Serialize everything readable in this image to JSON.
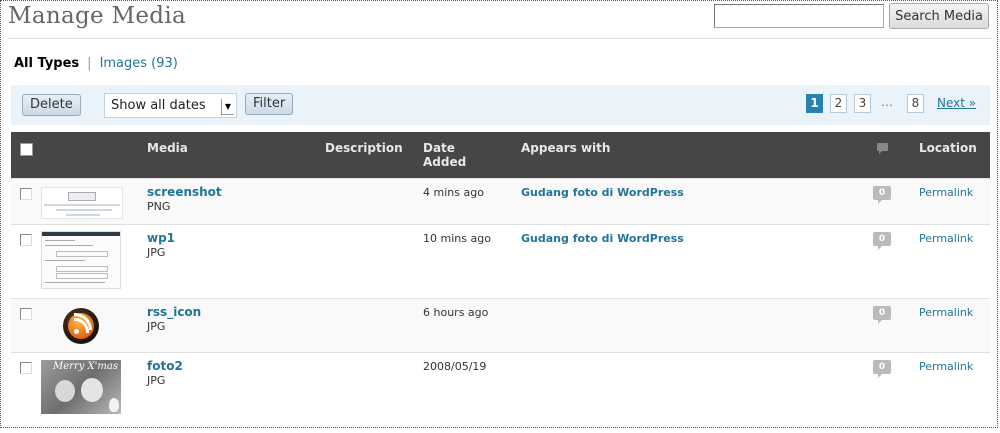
{
  "header": {
    "title": "Manage Media",
    "search_placeholder": "",
    "search_button": "Search Media"
  },
  "filters": {
    "current": "All Types",
    "separator": "|",
    "images_link": "Images (93)"
  },
  "tablenav": {
    "delete_label": "Delete",
    "date_select": "Show all dates",
    "filter_label": "Filter",
    "pages": [
      "1",
      "2",
      "3",
      "8"
    ],
    "current_page": "1",
    "ellipsis": "…",
    "next_label": "Next »"
  },
  "table": {
    "columns": {
      "media": "Media",
      "description": "Description",
      "date_line1": "Date",
      "date_line2": "Added",
      "appears": "Appears with",
      "comments_icon": "comment-icon",
      "location": "Location"
    },
    "rows": [
      {
        "title": "screenshot",
        "type": "PNG",
        "date": "4 mins ago",
        "appears": "Gudang foto di WordPress",
        "comments": "0",
        "location": "Permalink",
        "thumb": "screenshot-thumbnail"
      },
      {
        "title": "wp1",
        "type": "JPG",
        "date": "10 mins ago",
        "appears": "Gudang foto di WordPress",
        "comments": "0",
        "location": "Permalink",
        "thumb": "wp1-thumbnail"
      },
      {
        "title": "rss_icon",
        "type": "JPG",
        "date": "6 hours ago",
        "appears": "",
        "comments": "0",
        "location": "Permalink",
        "thumb": "rss-icon-thumbnail"
      },
      {
        "title": "foto2",
        "type": "JPG",
        "date": "2008/05/19",
        "appears": "",
        "comments": "0",
        "location": "Permalink",
        "thumb": "foto2-thumbnail",
        "thumb_text": "Merry X'mas"
      }
    ]
  },
  "colors": {
    "link": "#21759b",
    "header_bg": "#464646",
    "nav_bg": "#eaf2fa",
    "current_page_bg": "#2583ad"
  }
}
